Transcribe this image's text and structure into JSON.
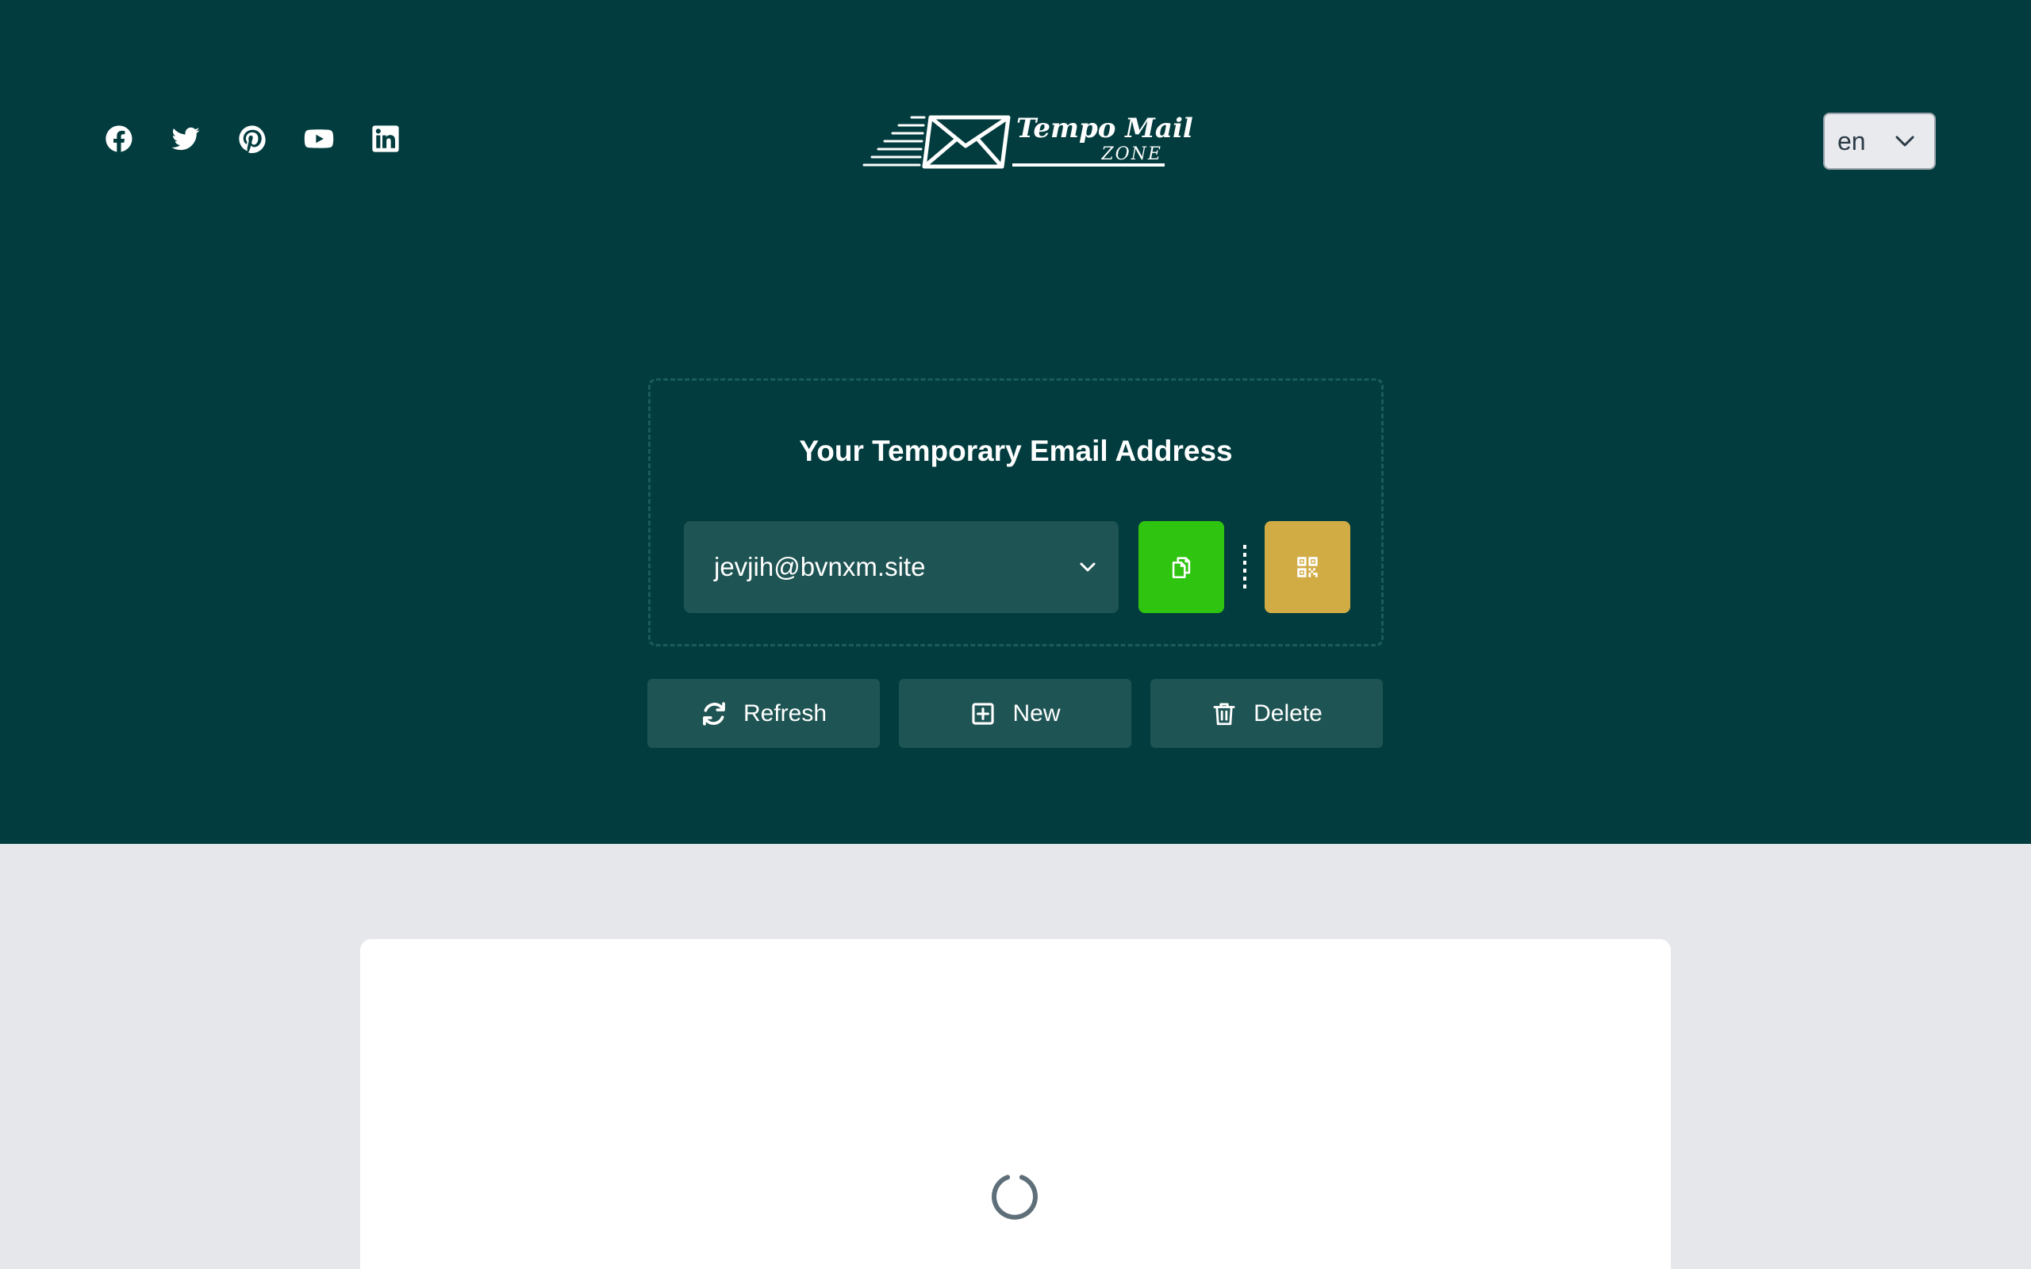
{
  "header": {
    "social_icons": [
      "facebook-icon",
      "twitter-icon",
      "pinterest-icon",
      "youtube-icon",
      "linkedin-icon"
    ],
    "logo": {
      "title": "Tempo Mail",
      "subtitle": "ZONE"
    },
    "language": {
      "selected": "en"
    }
  },
  "email_card": {
    "heading": "Your Temporary Email Address",
    "address": "jevjih@bvnxm.site"
  },
  "actions": {
    "refresh_label": "Refresh",
    "new_label": "New",
    "delete_label": "Delete"
  },
  "colors": {
    "hero_bg": "#023c3e",
    "control_bg": "#1e5453",
    "copy_green": "#2fc40f",
    "qr_gold": "#d1ab44",
    "page_bg": "#e5e7eb"
  }
}
